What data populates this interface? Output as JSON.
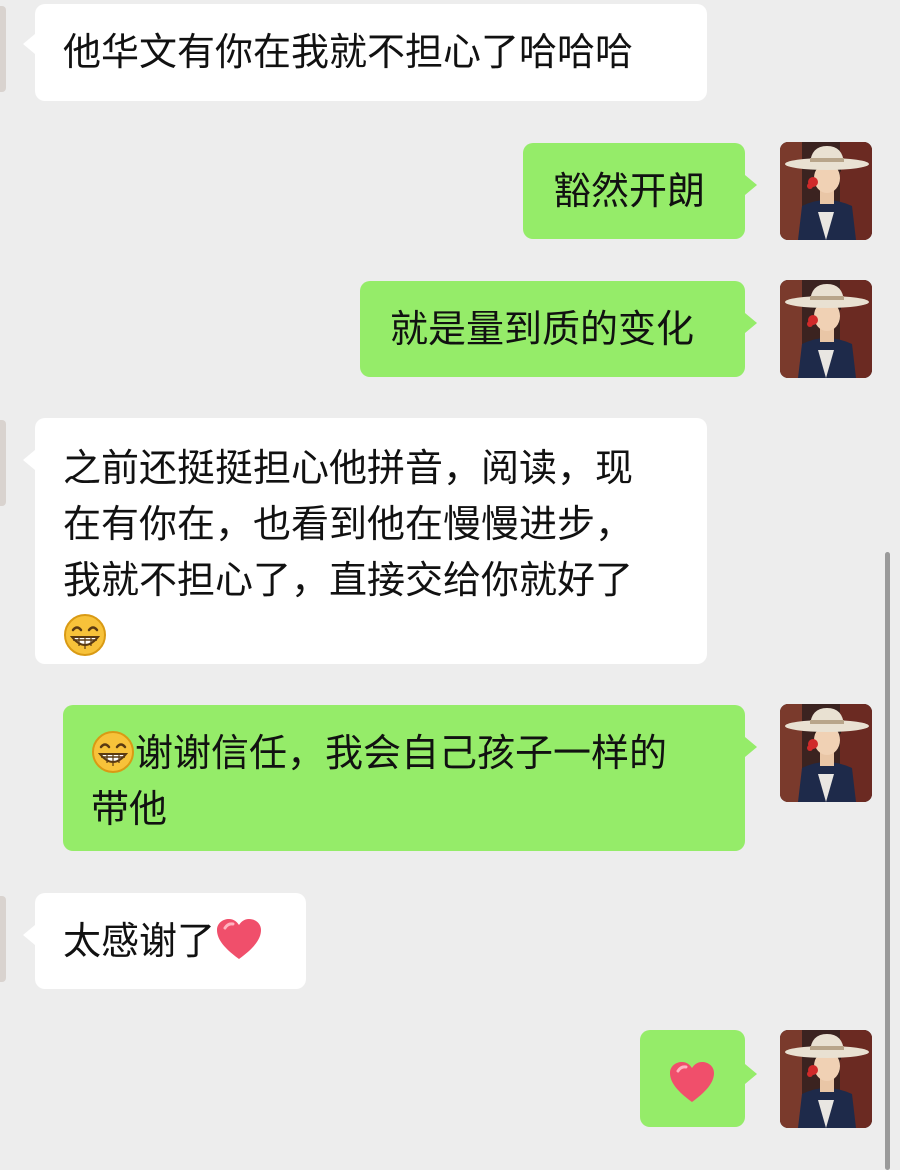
{
  "messages": [
    {
      "side": "in",
      "text": "他华文有你在我就不担心了哈哈哈"
    },
    {
      "side": "out",
      "text": "豁然开朗"
    },
    {
      "side": "out",
      "text": "就是量到质的变化"
    },
    {
      "side": "in",
      "lines": [
        "之前还挺挺担心他拼音，阅读，现",
        "在有你在，也看到他在慢慢进步，",
        "我就不担心了，直接交给你就好了"
      ],
      "trailing_emoji": "grinning-face-emoji"
    },
    {
      "side": "out",
      "leading_emoji": "grinning-face-emoji",
      "lines": [
        "谢谢信任，我会自己孩子一样的",
        "带他"
      ]
    },
    {
      "side": "in",
      "text": "太感谢了",
      "trailing_emoji": "red-heart-emoji"
    },
    {
      "side": "out",
      "emoji": "red-heart-emoji"
    }
  ],
  "avatar_icon": "user-avatar-hat-woman-icon",
  "colors": {
    "background": "#ededed",
    "incoming_bubble": "#ffffff",
    "outgoing_bubble": "#95ec69",
    "heart": "#f04f6b"
  }
}
